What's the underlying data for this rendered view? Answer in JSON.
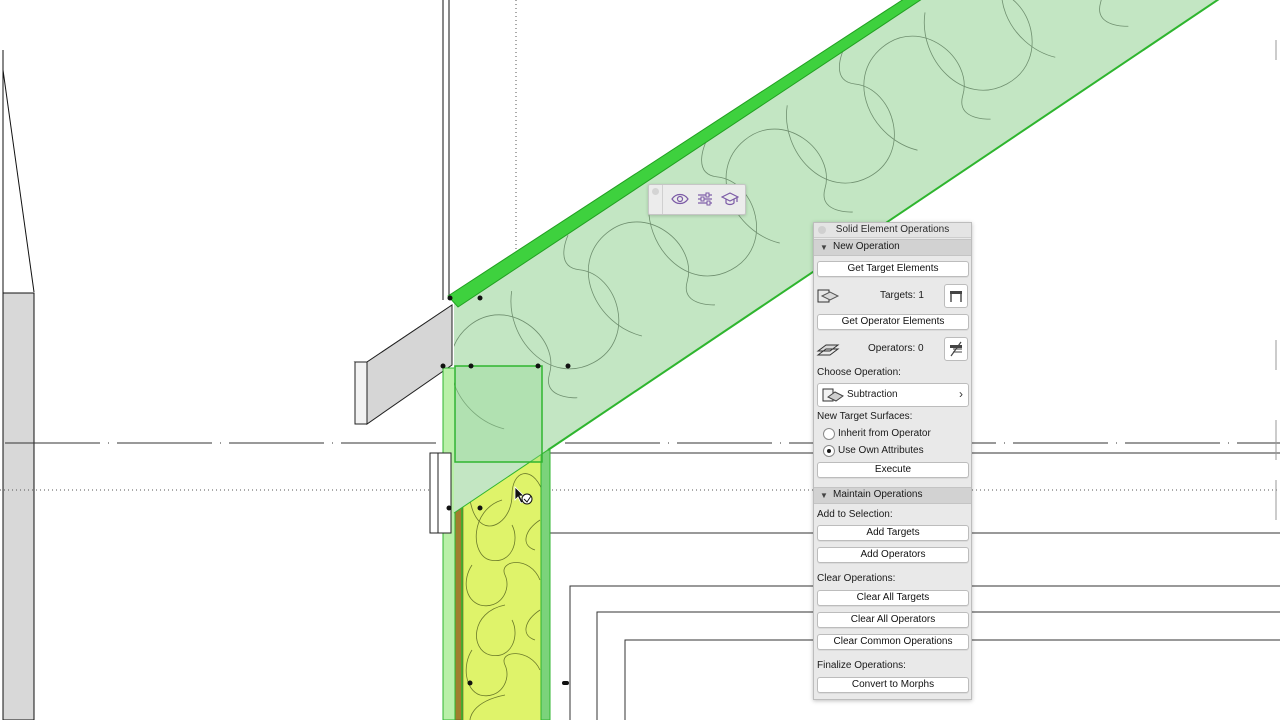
{
  "palette": {
    "title": "Solid Element Operations",
    "new_operation": {
      "header": "New Operation",
      "get_targets_label": "Get Target Elements",
      "targets_label": "Targets: 1",
      "get_operators_label": "Get Operator Elements",
      "operators_label": "Operators: 0",
      "choose_operation_label": "Choose Operation:",
      "operation_value": "Subtraction",
      "new_target_surfaces_label": "New Target Surfaces:",
      "surface_options": [
        "Inherit from Operator",
        "Use Own Attributes"
      ],
      "surface_selected": "Use Own Attributes",
      "execute_label": "Execute"
    },
    "maintain_operations": {
      "header": "Maintain Operations",
      "add_to_selection_label": "Add to Selection:",
      "add_targets_label": "Add Targets",
      "add_operators_label": "Add Operators",
      "clear_operations_label": "Clear Operations:",
      "clear_all_targets_label": "Clear All Targets",
      "clear_all_operators_label": "Clear All Operators",
      "clear_common_label": "Clear Common Operations",
      "finalize_label": "Finalize Operations:",
      "convert_label": "Convert to Morphs"
    }
  },
  "mini_toolbar": {
    "icons": [
      "eye-icon",
      "sliders-icon",
      "graduation-cap-icon"
    ],
    "icon_color": "#7b5aa6"
  },
  "colors": {
    "roof_fill": "#c3e6c3",
    "roof_edge": "#2fb52f",
    "wall_fill": "#dff36a",
    "selection_green": "#3ed13e",
    "palette_bg": "#e9e9e9"
  }
}
